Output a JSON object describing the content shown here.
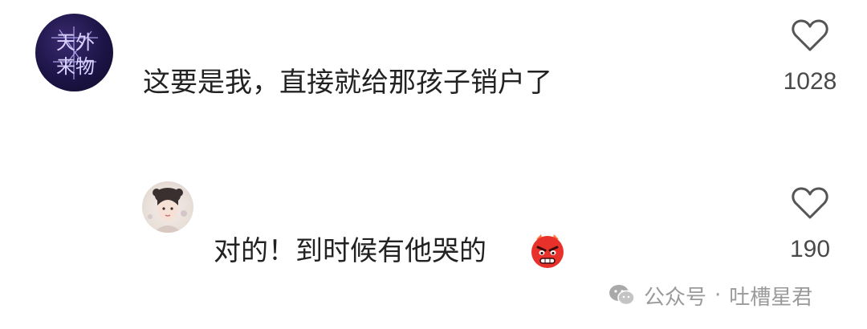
{
  "comments": [
    {
      "avatar_text": [
        "天外",
        "来物"
      ],
      "text": "这要是我，直接就给那孩子销户了",
      "likes": "1028"
    },
    {
      "text": "对的！到时候有他哭的",
      "emoji": "angry-face",
      "likes": "190"
    }
  ],
  "watermark": {
    "source": "公众号",
    "separator": "·",
    "account": "吐槽星君"
  },
  "icons": {
    "like": "heart-outline-icon",
    "watermark": "wechat-icon"
  }
}
